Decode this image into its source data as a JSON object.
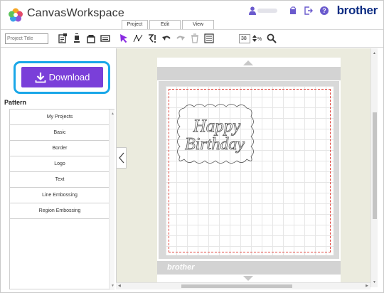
{
  "app": {
    "title": "CanvasWorkspace",
    "brand": "brother"
  },
  "tabs": [
    {
      "label": "Project"
    },
    {
      "label": "Edit"
    },
    {
      "label": "View"
    }
  ],
  "toolbar": {
    "project_title_placeholder": "Project Title",
    "zoom_value": "38",
    "zoom_unit": "%"
  },
  "left_panel": {
    "download_label": "Download",
    "pattern_heading": "Pattern",
    "pattern_items": [
      {
        "label": "My Projects"
      },
      {
        "label": "Basic"
      },
      {
        "label": "Border"
      },
      {
        "label": "Logo"
      },
      {
        "label": "Text"
      },
      {
        "label": "Line Embossing"
      },
      {
        "label": "Region Embossing"
      }
    ]
  },
  "mat": {
    "brand_mark": "brother"
  },
  "design": {
    "line1": "Happy",
    "line2": "Birthday"
  },
  "colors": {
    "download_button": "#7a3fd9",
    "highlight_ring": "#1aa7e8",
    "brand": "#0d2d83",
    "select_arrow": "#8a2be2",
    "cut_boundary": "#e0443c"
  }
}
